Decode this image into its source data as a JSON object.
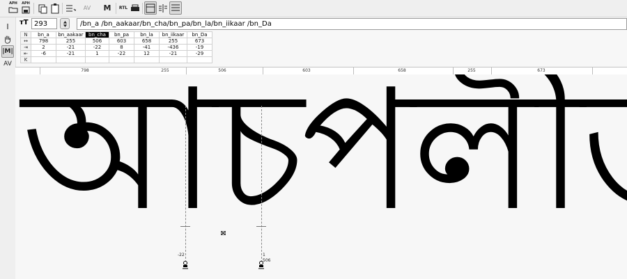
{
  "toolbar": {
    "buttons": [
      {
        "name": "aph-open-button",
        "caption": "APH",
        "icon": "folder-icon"
      },
      {
        "name": "aph-save-button",
        "caption": "APH",
        "icon": "save-icon"
      },
      {
        "name": "copy-button",
        "caption": "",
        "icon": "copy-icon"
      },
      {
        "name": "paste-button",
        "caption": "",
        "icon": "paste-icon"
      },
      {
        "name": "list-button",
        "caption": "",
        "icon": "list-icon"
      },
      {
        "name": "kern-av-button",
        "caption": "",
        "icon": "kern-icon",
        "label": "AV"
      },
      {
        "name": "metrics-button",
        "caption": "",
        "icon": "m-icon",
        "label": "M"
      },
      {
        "name": "rtl-button",
        "caption": "",
        "icon": "rtl-icon",
        "label": "RTL"
      },
      {
        "name": "print-button",
        "caption": "",
        "icon": "print-icon"
      },
      {
        "name": "view-top-button",
        "caption": "",
        "icon": "view-top-icon"
      },
      {
        "name": "view-split-button",
        "caption": "",
        "icon": "view-split-icon"
      },
      {
        "name": "view-bottom-button",
        "caption": "",
        "icon": "view-bottom-icon"
      }
    ]
  },
  "left_tools": {
    "text_tool": "I",
    "hand_tool": "hand-icon",
    "metrics_tool": "|M|",
    "kern_tool": "AV"
  },
  "size": {
    "label": "ᴛT",
    "value": "293"
  },
  "text_field": {
    "value": "/bn_a /bn_aakaar/bn_cha/bn_pa/bn_la/bn_iikaar /bn_Da"
  },
  "metrics_table": {
    "row_headers": [
      "N",
      "↔",
      "⇥",
      "⇤",
      "K"
    ],
    "glyphs": [
      "bn_a",
      "bn_aakaar",
      "bn_cha",
      "bn_pa",
      "bn_la",
      "bn_iikaar",
      "bn_Da"
    ],
    "selected_index": 2,
    "widths": [
      "798",
      "255",
      "506",
      "603",
      "658",
      "255",
      "673"
    ],
    "lsb": [
      "2",
      "-21",
      "-22",
      "8",
      "-41",
      "-436",
      "-19"
    ],
    "rsb": [
      "-6",
      "-21",
      "1",
      "-22",
      "12",
      "-21",
      "-29"
    ]
  },
  "ruler": {
    "labels": [
      "798",
      "255",
      "506",
      "603",
      "658",
      "255",
      "673"
    ]
  },
  "canvas": {
    "glyph_text": "আচপলীড",
    "kern_left_label": "-22",
    "kern_right_label": "1",
    "width_label": "506"
  }
}
